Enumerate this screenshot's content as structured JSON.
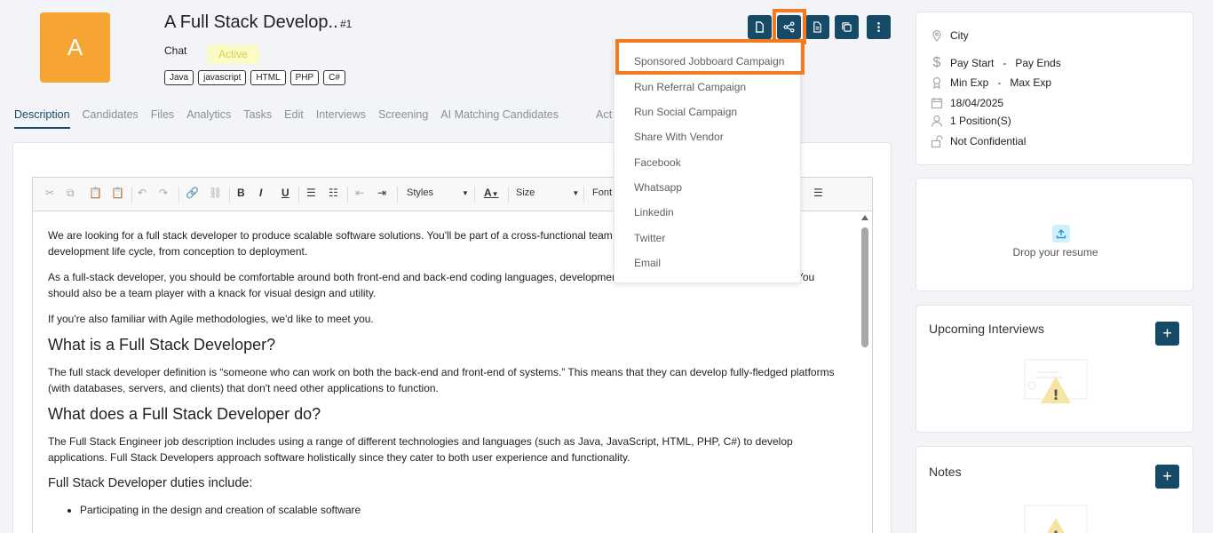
{
  "header": {
    "avatar_letter": "A",
    "title": "A Full Stack Develop..",
    "job_id": "#1",
    "chat_label": "Chat",
    "status": "Active",
    "tags": [
      "Java",
      "javascript",
      "HTML",
      "PHP",
      "C#"
    ]
  },
  "tabs": [
    {
      "label": "Description",
      "active": true
    },
    {
      "label": "Candidates"
    },
    {
      "label": "Files"
    },
    {
      "label": "Analytics"
    },
    {
      "label": "Tasks"
    },
    {
      "label": "Edit"
    },
    {
      "label": "Interviews"
    },
    {
      "label": "Screening"
    },
    {
      "label": "AI Matching Candidates"
    }
  ],
  "tab_overflow": "Act",
  "toolbar": {
    "styles_label": "Styles",
    "size_label": "Size",
    "font_label": "Font",
    "bold": "B",
    "italic": "I",
    "underline": "U",
    "font_color": "A"
  },
  "content": {
    "p1": "We are looking for a full stack developer to produce scalable software solutions. You'll be part of a cross-functional team that's responsible for the full software development life cycle, from conception to deployment.",
    "p2": "As a full-stack developer, you should be comfortable around both front-end and back-end coding languages, development frameworks and third-party libraries. You should also be a team player with a knack for visual design and utility.",
    "p3": "If you're also familiar with Agile methodologies, we'd like to meet you.",
    "h1": "What is a Full Stack Developer?",
    "p4": "The full stack developer definition is “someone who can work on both the back-end and front-end of systems.” This means that they can develop fully-fledged platforms (with databases, servers, and clients) that don't need other applications to function.",
    "h2": "What does a Full Stack Developer do?",
    "p5": "The Full Stack Engineer job description includes using a range of different technologies and languages (such as Java, JavaScript, HTML, PHP, C#) to develop applications. Full Stack Developers approach software holistically since they cater to both user experience and functionality.",
    "h3": "Full Stack Developer duties include:",
    "li1": "Participating in the design and creation of scalable software"
  },
  "share_menu": [
    "Sponsored Jobboard Campaign",
    "Run Referral Campaign",
    "Run Social Campaign",
    "Share With Vendor",
    "Facebook",
    "Whatsapp",
    "Linkedin",
    "Twitter",
    "Email"
  ],
  "details": {
    "city": "City",
    "pay_start": "Pay Start",
    "pay_end": "Pay Ends",
    "pay_sep": "-",
    "min_exp": "Min Exp",
    "max_exp": "Max Exp",
    "exp_sep": "-",
    "date": "18/04/2025",
    "positions": "1 Position(S)",
    "confidential": "Not Confidential"
  },
  "resume": {
    "label": "Drop your resume"
  },
  "interviews": {
    "title": "Upcoming Interviews",
    "add": "+"
  },
  "notes": {
    "title": "Notes",
    "add": "+"
  },
  "colors": {
    "primary": "#174a66",
    "avatar": "#f7a532",
    "highlight": "#f47a1f",
    "active_badge_bg": "#fbfbc9",
    "active_badge_text": "#d8cf37"
  }
}
